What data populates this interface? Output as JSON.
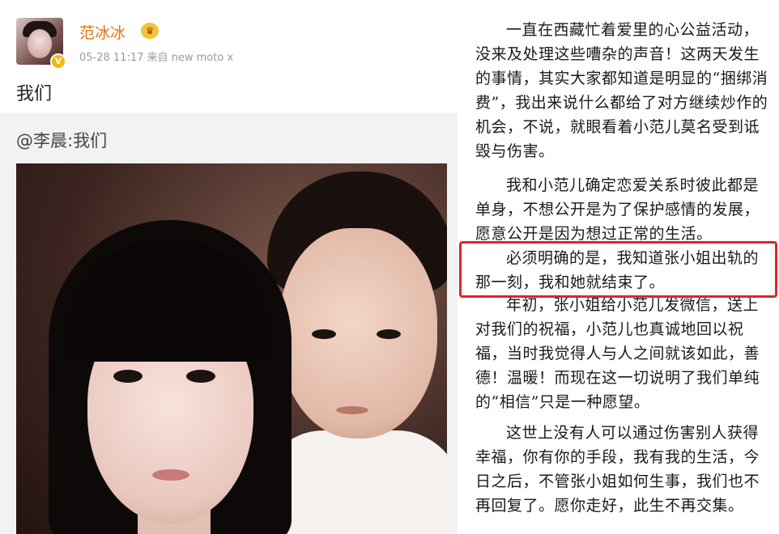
{
  "post": {
    "username": "范冰冰",
    "verified_badge": "V",
    "member_icon": "crown-icon",
    "meta": "05-28 11:17  来自 new moto x",
    "text": "我们",
    "repost_text": "@李晨:我们"
  },
  "statement": {
    "paragraphs": [
      "一直在西藏忙着爱里的心公益活动，没来及处理这些嘈杂的声音！这两天发生的事情，其实大家都知道是明显的“捆绑消费”，我出来说什么都给了对方继续炒作的机会，不说，就眼看着小范儿莫名受到诋毁与伤害。",
      "我和小范儿确定恋爱关系时彼此都是单身，不想公开是为了保护感情的发展，愿意公开是因为想过正常的生活。",
      "必须明确的是，我知道张小姐出轨的那一刻，我和她就结束了。",
      "年初，张小姐给小范儿发微信，送上对我们的祝福，小范儿也真诚地回以祝福，当时我觉得人与人之间就该如此，善德！温暖！而现在这一切说明了我们单纯的“相信”只是一种愿望。",
      "这世上没有人可以通过伤害别人获得幸福，你有你的手段，我有我的生活，今日之后，不管张小姐如何生事，我们也不再回复了。愿你走好，此生不再交集。"
    ]
  },
  "colors": {
    "username": "#e8700f",
    "highlight_border": "#e0242b",
    "repost_bg": "#f2f2f2"
  }
}
